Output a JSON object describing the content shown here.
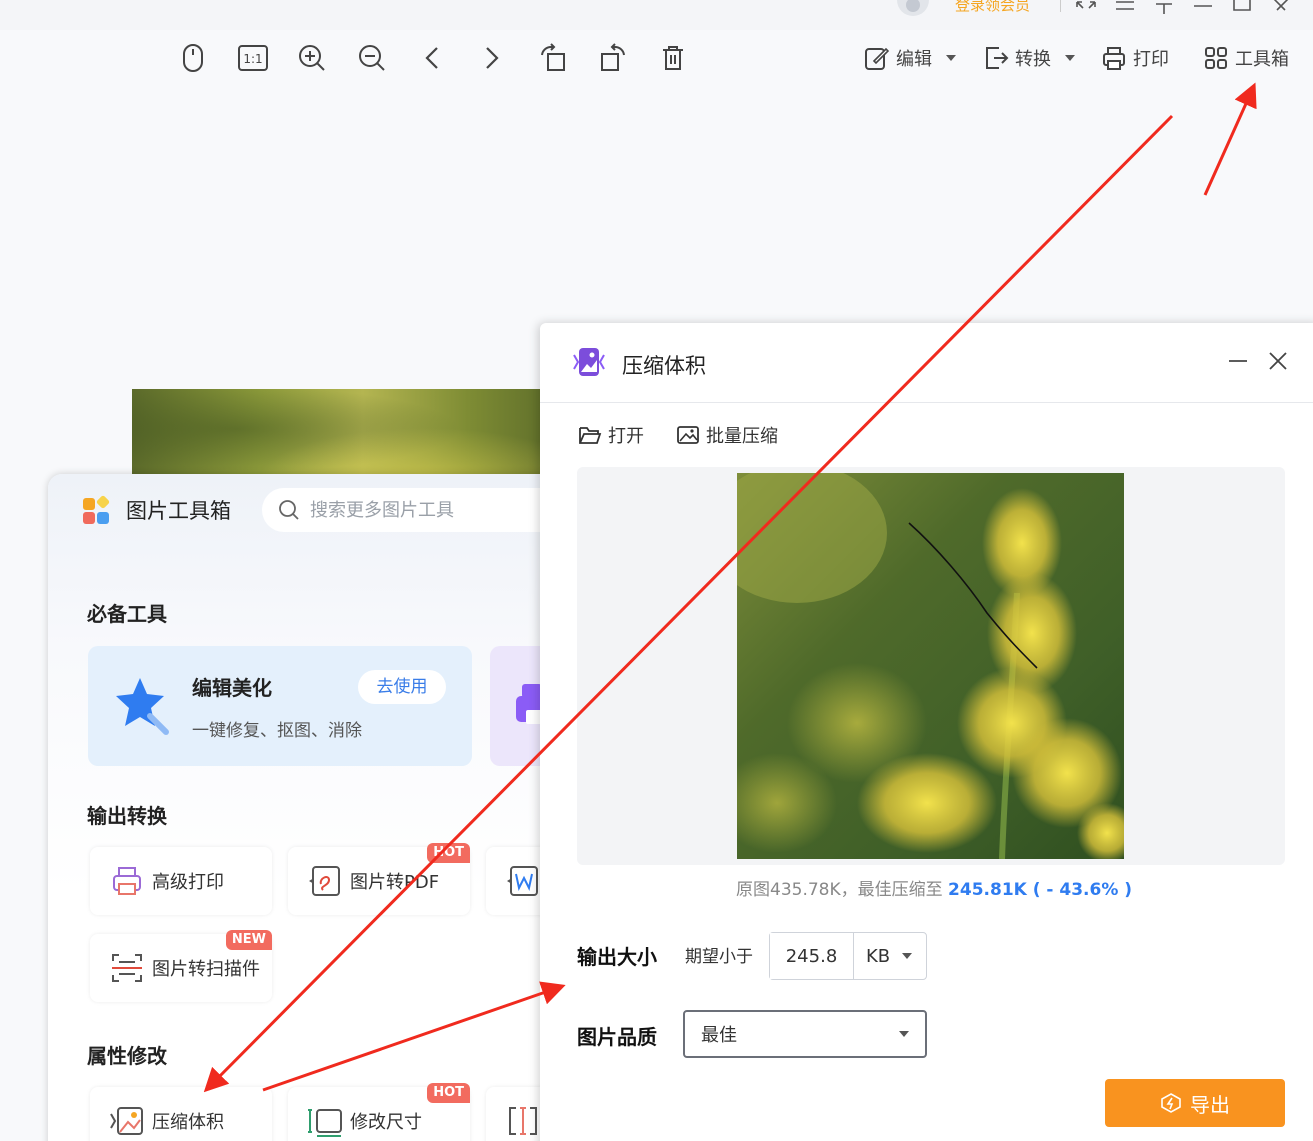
{
  "titlebar": {
    "login_text": "登录领会员",
    "icons": [
      "avatar-icon",
      "fullscreen-icon",
      "menu-icon",
      "pin-icon",
      "minimize-icon",
      "maximize-icon",
      "close-icon"
    ]
  },
  "viewer_toolbar": {
    "icons": [
      "mouse-icon",
      "actual-size-icon",
      "zoom-in-icon",
      "zoom-out-icon",
      "previous-icon",
      "next-icon",
      "rotate-left-icon",
      "rotate-right-icon",
      "delete-icon"
    ],
    "actual_size_label": "1:1",
    "edit_label": "编辑",
    "convert_label": "转换",
    "print_label": "打印",
    "toolbox_label": "工具箱"
  },
  "toolbox": {
    "title": "图片工具箱",
    "search_placeholder": "搜索更多图片工具",
    "section_essential": "必备工具",
    "featured": {
      "name": "编辑美化",
      "desc": "一键修复、抠图、消除",
      "button": "去使用"
    },
    "section_output": "输出转换",
    "output_tools": [
      {
        "label": "高级打印",
        "badge": ""
      },
      {
        "label": "图片转PDF",
        "badge": "HOT"
      },
      {
        "label": "图片转扫描件",
        "badge": "NEW"
      }
    ],
    "section_attr": "属性修改",
    "attr_tools": [
      {
        "label": "压缩体积",
        "badge": ""
      },
      {
        "label": "修改尺寸",
        "badge": "HOT"
      }
    ]
  },
  "dialog": {
    "title": "压缩体积",
    "open_label": "打开",
    "batch_label": "批量压缩",
    "info_prefix": "原图435.78K，最佳压缩至 ",
    "info_highlight": "245.81K ( - 43.6% )",
    "output_size_label": "输出大小",
    "expect_label": "期望小于",
    "size_value": "245.8",
    "size_unit": "KB",
    "quality_label": "图片品质",
    "quality_value": "最佳",
    "export_label": "导出"
  },
  "colors": {
    "accent_orange": "#f9931f",
    "highlight_blue": "#2f7cf0",
    "arrow_red": "#f02a1e",
    "login_orange": "#f5a623"
  }
}
